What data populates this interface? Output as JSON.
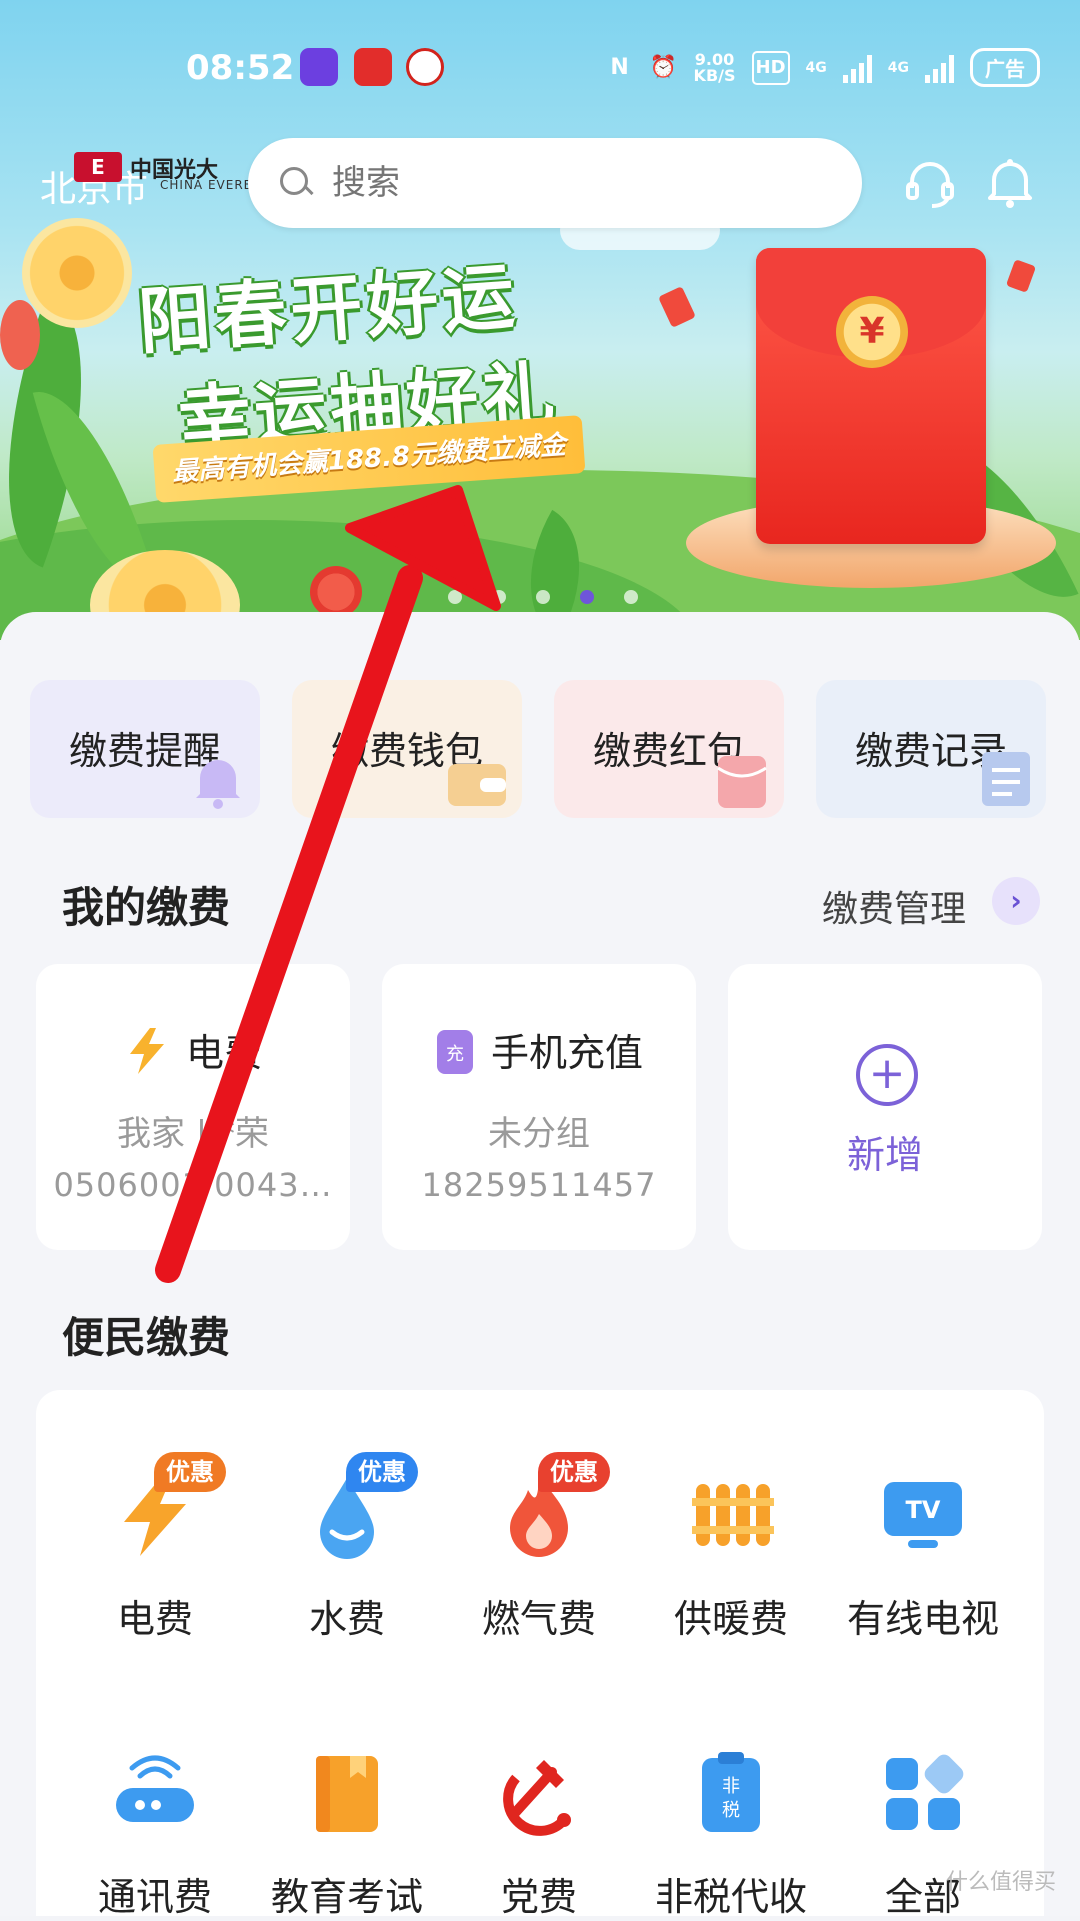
{
  "status_bar": {
    "time": "08:52",
    "speed_value": "9.00",
    "speed_unit": "KB/S",
    "hd": "HD",
    "net1": "4G",
    "net2": "4G",
    "battery": "广告"
  },
  "header": {
    "city": "北京市",
    "brand_name": "中国光大",
    "brand_sub": "CHINA EVERBRIG",
    "brand_logo_text": "E",
    "search_placeholder": "搜索"
  },
  "banner": {
    "line1": "阳春开好运",
    "line2": "幸运抽好礼",
    "ribbon": "最高有机会赢188.8元缴费立减金",
    "coin": "¥",
    "slide_count": 5,
    "active_slide_index": 3
  },
  "quick_actions": [
    {
      "label": "缴费提醒",
      "icon": "bell-icon"
    },
    {
      "label": "缴费钱包",
      "icon": "wallet-icon"
    },
    {
      "label": "缴费红包",
      "icon": "red-packet-icon"
    },
    {
      "label": "缴费记录",
      "icon": "receipt-icon"
    }
  ],
  "my_payments": {
    "title": "我的缴费",
    "manage_label": "缴费管理",
    "cards": [
      {
        "title": "电费",
        "subtitle": "我家 | *荣",
        "account": "0506001·0043…",
        "icon": "lightning-icon"
      },
      {
        "title": "手机充值",
        "subtitle": "未分组",
        "account": "18259511457",
        "icon": "phone-recharge-icon"
      }
    ],
    "add_label": "新增"
  },
  "services": {
    "title": "便民缴费",
    "items": [
      {
        "label": "电费",
        "icon": "lightning-icon",
        "badge": "优惠",
        "badge_color": "#f07a24"
      },
      {
        "label": "水费",
        "icon": "water-drop-icon",
        "badge": "优惠",
        "badge_color": "#2f86f0"
      },
      {
        "label": "燃气费",
        "icon": "flame-icon",
        "badge": "优惠",
        "badge_color": "#e8412f"
      },
      {
        "label": "供暖费",
        "icon": "radiator-icon",
        "badge": "",
        "badge_color": ""
      },
      {
        "label": "有线电视",
        "icon": "tv-icon",
        "badge": "",
        "badge_color": ""
      },
      {
        "label": "通讯费",
        "icon": "router-icon",
        "badge": "",
        "badge_color": ""
      },
      {
        "label": "教育考试",
        "icon": "book-icon",
        "badge": "",
        "badge_color": ""
      },
      {
        "label": "党费",
        "icon": "party-emblem-icon",
        "badge": "",
        "badge_color": ""
      },
      {
        "label": "非税代收",
        "icon": "non-tax-icon",
        "badge": "",
        "badge_color": ""
      },
      {
        "label": "全部",
        "icon": "grid-all-icon",
        "badge": "",
        "badge_color": ""
      }
    ]
  },
  "watermark": "什么值得买",
  "colors": {
    "accent": "#7c62d8",
    "arrow": "#e8141c"
  }
}
